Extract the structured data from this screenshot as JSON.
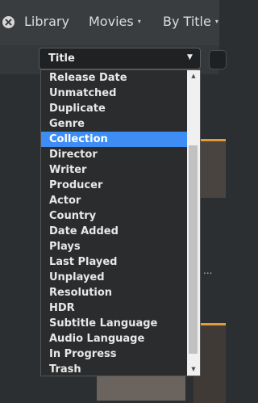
{
  "nav": {
    "close_icon": "close-circle-icon",
    "library_label": "Library",
    "movies_label": "Movies",
    "sort_label": "By Title",
    "caret_glyph": "▾"
  },
  "select": {
    "value": "Title",
    "caret_glyph": "▼"
  },
  "options": [
    {
      "label": "Release Date",
      "selected": false
    },
    {
      "label": "Unmatched",
      "selected": false
    },
    {
      "label": "Duplicate",
      "selected": false
    },
    {
      "label": "Genre",
      "selected": false
    },
    {
      "label": "Collection",
      "selected": true
    },
    {
      "label": "Director",
      "selected": false
    },
    {
      "label": "Writer",
      "selected": false
    },
    {
      "label": "Producer",
      "selected": false
    },
    {
      "label": "Actor",
      "selected": false
    },
    {
      "label": "Country",
      "selected": false
    },
    {
      "label": "Date Added",
      "selected": false
    },
    {
      "label": "Plays",
      "selected": false
    },
    {
      "label": "Last Played",
      "selected": false
    },
    {
      "label": "Unplayed",
      "selected": false
    },
    {
      "label": "Resolution",
      "selected": false
    },
    {
      "label": "HDR",
      "selected": false
    },
    {
      "label": "Subtitle Language",
      "selected": false
    },
    {
      "label": "Audio Language",
      "selected": false
    },
    {
      "label": "In Progress",
      "selected": false
    },
    {
      "label": "Trash",
      "selected": false
    }
  ],
  "scrollbar": {
    "up_glyph": "▲",
    "down_glyph": "▼"
  },
  "colors": {
    "selected_bg": "#3d8df5",
    "accent_orange": "#e59a3a"
  },
  "background": {
    "ellipsis": "..."
  }
}
